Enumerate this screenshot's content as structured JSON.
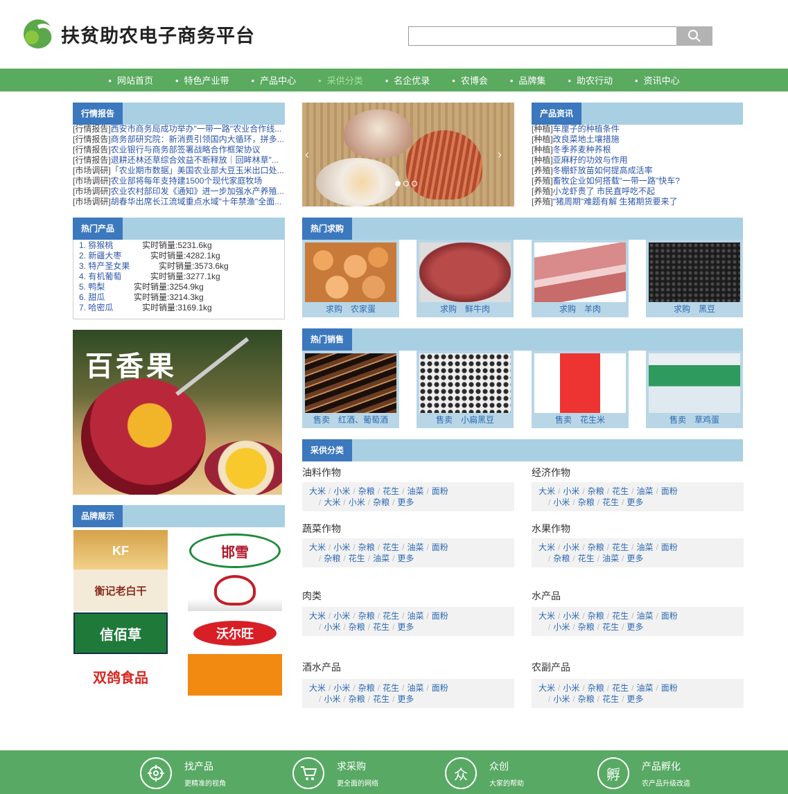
{
  "header": {
    "site_title": "扶贫助农电子商务平台",
    "search_placeholder": ""
  },
  "nav": [
    "网站首页",
    "特色产业带",
    "产品中心",
    "采供分类",
    "名企优录",
    "农博会",
    "品牌集",
    "助农行动",
    "资讯中心"
  ],
  "market_report": {
    "title": "行情报告",
    "items": [
      {
        "tag": "[行情报告]",
        "text": "西安市商务局成功举办\"一带一路\"农业合作线..."
      },
      {
        "tag": "[行情报告]",
        "text": "商务部研究院：新消费引领国内大循环，拼多..."
      },
      {
        "tag": "[行情报告]",
        "text": "农业银行与商务部签署战略合作框架协议"
      },
      {
        "tag": "[行情报告]",
        "text": "退耕还林还草综合效益不断释放｜回眸林草\"..."
      },
      {
        "tag": "[市场调研]",
        "text": "「农业期市数据」美国农业部大豆玉米出口处..."
      },
      {
        "tag": "[市场调研]",
        "text": "农业部将每年支持建1500个现代家庭牧场"
      },
      {
        "tag": "[市场调研]",
        "text": "农业农村部印发《通知》进一步加强水产养殖..."
      },
      {
        "tag": "[市场调研]",
        "text": "胡春华出席长江流域重点水域\"十年禁渔\"全面..."
      }
    ]
  },
  "product_news": {
    "title": "产品资讯",
    "items": [
      {
        "tag": "[种植]",
        "text": "车厘子的种植条件"
      },
      {
        "tag": "[种植]",
        "text": "改良菜地土壤措施"
      },
      {
        "tag": "[种植]",
        "text": "冬季荞麦种荞根"
      },
      {
        "tag": "[种植]",
        "text": "亚麻籽的功效与作用"
      },
      {
        "tag": "[养殖]",
        "text": "冬棚虾放苗如何提高成活率"
      },
      {
        "tag": "[养殖]",
        "text": "畜牧企业如何搭载\"一带一路\"快车?"
      },
      {
        "tag": "[养殖]",
        "text": "小龙虾贵了 市民直呼吃不起"
      },
      {
        "tag": "[养殖]",
        "text": "\"猪周期\"难题有解 生猪期货要来了"
      }
    ]
  },
  "hot_products": {
    "title": "热门产品",
    "items": [
      {
        "name": "1. 猕猴桃",
        "sales": "实时销量:5231.6kg"
      },
      {
        "name": "2. 新疆大枣",
        "sales": "实时销量:4282.1kg"
      },
      {
        "name": "3. 特产圣女果",
        "sales": "实时销量:3573.6kg"
      },
      {
        "name": "4. 有机葡萄",
        "sales": "实时销量:3277.1kg"
      },
      {
        "name": "5. 鸭梨",
        "sales": "实时销量:3254.9kg"
      },
      {
        "name": "6. 甜瓜",
        "sales": "实时销量:3214.3kg"
      },
      {
        "name": "7. 哈密瓜",
        "sales": "实时销量:3169.1kg"
      }
    ]
  },
  "banner": {
    "text": "百香果"
  },
  "hot_buy": {
    "title": "热门求购",
    "items": [
      {
        "caption": "求购　农家蛋",
        "color": "#e8a25a"
      },
      {
        "caption": "求购　鲜牛肉",
        "color": "#b4474a"
      },
      {
        "caption": "求购　羊肉",
        "color": "#d8a0a0"
      },
      {
        "caption": "求购　黑豆",
        "color": "#2a2a2a"
      }
    ]
  },
  "hot_sale": {
    "title": "热门销售",
    "items": [
      {
        "caption": "售卖　红酒、葡萄酒",
        "color": "#5a3522"
      },
      {
        "caption": "售卖　小扁黑豆",
        "color": "#3a3a3a"
      },
      {
        "caption": "售卖　花生米",
        "color": "#d88a3a"
      },
      {
        "caption": "售卖　草鸡蛋",
        "color": "#3fa070"
      }
    ]
  },
  "purchase_category": {
    "title": "采供分类",
    "groups": [
      {
        "title": "油料作物",
        "row1": [
          "大米",
          "小米",
          "杂粮",
          "花生",
          "油菜",
          "面粉"
        ],
        "row2": [
          "大米",
          "小米",
          "杂粮",
          "更多"
        ]
      },
      {
        "title": "经济作物",
        "row1": [
          "大米",
          "小米",
          "杂粮",
          "花生",
          "油菜",
          "面粉"
        ],
        "row2": [
          "小米",
          "杂粮",
          "花生",
          "更多"
        ]
      },
      {
        "title": "蔬菜作物",
        "row1": [
          "大米",
          "小米",
          "杂粮",
          "花生",
          "油菜",
          "面粉"
        ],
        "row2": [
          "杂粮",
          "花生",
          "油菜",
          "更多"
        ]
      },
      {
        "title": "水果作物",
        "row1": [
          "大米",
          "小米",
          "杂粮",
          "花生",
          "油菜",
          "面粉"
        ],
        "row2": [
          "杂粮",
          "花生",
          "油菜",
          "更多"
        ]
      },
      {
        "title": "肉类",
        "row1": [
          "大米",
          "小米",
          "杂粮",
          "花生",
          "油菜",
          "面粉"
        ],
        "row2": [
          "小米",
          "杂粮",
          "花生",
          "更多"
        ]
      },
      {
        "title": "水产品",
        "row1": [
          "大米",
          "小米",
          "杂粮",
          "花生",
          "油菜",
          "面粉"
        ],
        "row2": [
          "小米",
          "杂粮",
          "花生",
          "更多"
        ]
      },
      {
        "title": "酒水产品",
        "row1": [
          "大米",
          "小米",
          "杂粮",
          "花生",
          "油菜",
          "面粉"
        ],
        "row2": [
          "小米",
          "杂粮",
          "花生",
          "更多"
        ]
      },
      {
        "title": "农副产品",
        "row1": [
          "大米",
          "小米",
          "杂粮",
          "花生",
          "油菜",
          "面粉"
        ],
        "row2": [
          "小米",
          "杂粮",
          "花生",
          "更多"
        ]
      }
    ]
  },
  "brands": {
    "title": "品牌展示",
    "items": [
      "KF",
      "邯雪",
      "衡记老白干",
      "",
      "信佰草",
      "沃尔旺",
      "双鸽食品",
      ""
    ]
  },
  "footer": {
    "items": [
      {
        "title": "找产品",
        "sub": "更精准的视角",
        "icon": "⊕"
      },
      {
        "title": "求采购",
        "sub": "更全面的网络",
        "icon": "🛒"
      },
      {
        "title": "众创",
        "sub": "大家的帮助",
        "icon": "众"
      },
      {
        "title": "产品孵化",
        "sub": "农产品升级改造",
        "icon": "孵"
      }
    ]
  },
  "colors": {
    "green": "#5aaa5f",
    "blue": "#3b78bd",
    "light_blue": "#a9cfe3"
  }
}
